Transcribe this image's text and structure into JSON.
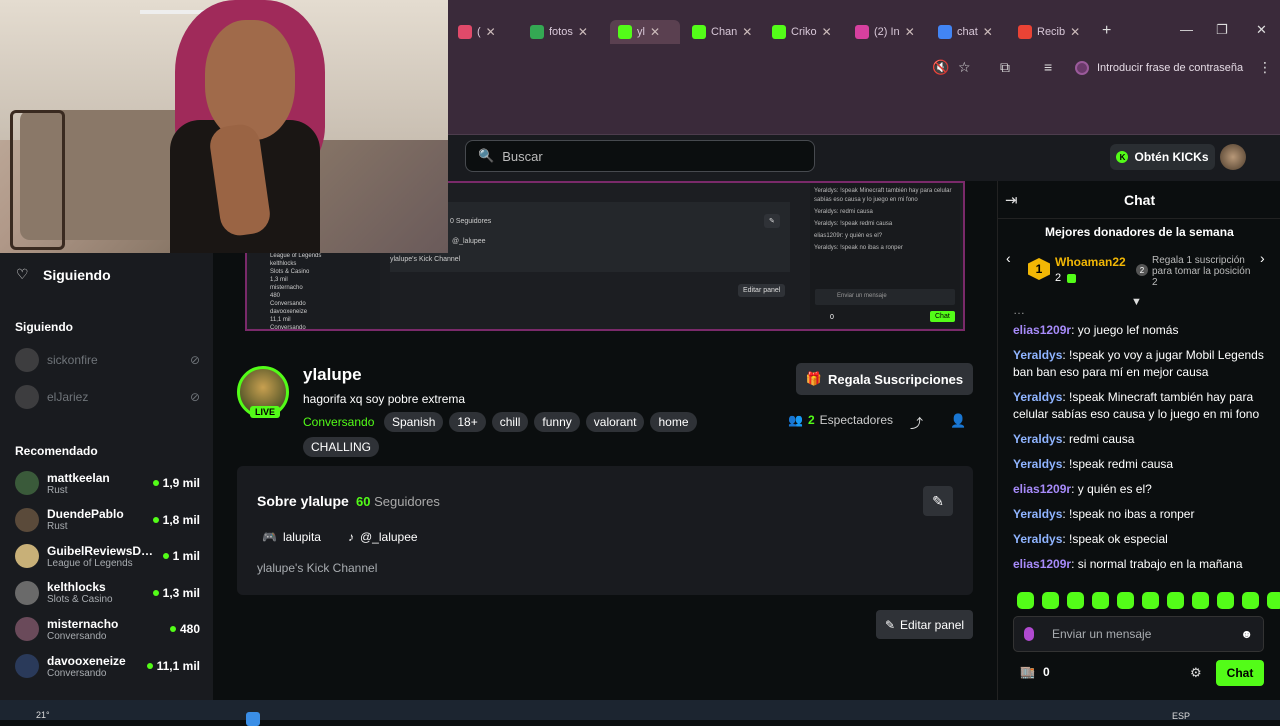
{
  "browser": {
    "tabs": [
      {
        "label": "(",
        "icon_color": "#e04a6a",
        "active": false
      },
      {
        "label": "fotos",
        "icon_color": "#34a853",
        "active": false
      },
      {
        "label": "yl",
        "icon_color": "#53fc18",
        "active": true
      },
      {
        "label": "Chan",
        "icon_color": "#53fc18",
        "active": false
      },
      {
        "label": "Criko",
        "icon_color": "#53fc18",
        "active": false
      },
      {
        "label": "(2) In",
        "icon_color": "#d6409f",
        "active": false
      },
      {
        "label": "chat",
        "icon_color": "#4285f4",
        "active": false
      },
      {
        "label": "Recib",
        "icon_color": "#ea4335",
        "active": false
      }
    ],
    "new_tab": "+",
    "minimize": "—",
    "maximize": "❐",
    "close": "✕",
    "password_prompt": "Introducir frase de contraseña"
  },
  "topbar": {
    "search_placeholder": "Buscar",
    "kicks_label": "Obtén KICKs"
  },
  "sidebar": {
    "following_title": "Siguiendo",
    "following_section": "Siguiendo",
    "following": [
      {
        "name": "sickonfire"
      },
      {
        "name": "elJariez"
      }
    ],
    "recommended_section": "Recomendado",
    "recommended": [
      {
        "name": "mattkeelan",
        "category": "Rust",
        "viewers": "1,9 mil",
        "color": "#3a5a3a"
      },
      {
        "name": "DuendePablo",
        "category": "Rust",
        "viewers": "1,8 mil",
        "color": "#5a4a3a"
      },
      {
        "name": "GuibelReviewsDir...",
        "category": "League of Legends",
        "viewers": "1 mil",
        "color": "#c8b078"
      },
      {
        "name": "kelthlocks",
        "category": "Slots & Casino",
        "viewers": "1,3 mil",
        "color": "#6a6a6a"
      },
      {
        "name": "misternacho",
        "category": "Conversando",
        "viewers": "480",
        "color": "#6a4a5a"
      },
      {
        "name": "davooxeneize",
        "category": "Conversando",
        "viewers": "11,1 mil",
        "color": "#2a3a5a"
      }
    ]
  },
  "video_preview": {
    "followers_text": "0 Seguidores",
    "tiktok": "@_lalupee",
    "channel_desc": "ylalupe's Kick Channel",
    "edit_panel": "Editar panel",
    "sidebar_items": [
      "League of Legends",
      "kelthlocks",
      "Slots & Casino",
      "1,3 mil",
      "misternacho",
      "480",
      "Conversando",
      "davooxeneize",
      "11,1 mil",
      "Conversando"
    ],
    "chat_lines": [
      "Yeraldys: !speak Minecraft también hay para celular sabías eso causa y lo juego en mi fono",
      "Yeraldys: redmi causa",
      "Yeraldys: !speak redmi causa",
      "elias1209r: y quién es el?",
      "Yeraldys: !speak no ibas a ronper"
    ],
    "send_placeholder": "Enviar un mensaje",
    "chat_btn": "Chat",
    "points": "0"
  },
  "channel": {
    "name": "ylalupe",
    "live": "LIVE",
    "title": "hagorifa xq soy pobre extrema",
    "category": "Conversando",
    "tags": [
      "Spanish",
      "18+",
      "chill",
      "funny",
      "valorant",
      "home"
    ],
    "tags2": [
      "CHALLING"
    ],
    "subscribe_btn": "Regala Suscripciones",
    "viewers_count": "2",
    "viewers_label": "Espectadores"
  },
  "about": {
    "title": "Sobre ylalupe",
    "followers_count": "60",
    "followers_label": "Seguidores",
    "discord": "lalupita",
    "tiktok": "@_lalupee",
    "description": "ylalupe's Kick Channel",
    "edit_panel": "Editar panel"
  },
  "chat": {
    "title": "Chat",
    "donors_title": "Mejores donadores de la semana",
    "donor_rank": "1",
    "donor_name": "Whoaman22",
    "donor_value": "2",
    "gift_num": "2",
    "gift_text": "Regala 1 suscripción para tomar la posición 2",
    "messages": [
      {
        "user": "elias1209r",
        "text": " yo juego lef nomás",
        "color": "#a78bfa"
      },
      {
        "user": "Yeraldys",
        "text": " !speak yo voy a jugar Mobil Legends ban ban eso para mí en mejor causa",
        "color": "#8fb4ff"
      },
      {
        "user": "Yeraldys",
        "text": " !speak Minecraft también hay para celular sabías eso causa y lo juego en mi fono",
        "color": "#8fb4ff"
      },
      {
        "user": "Yeraldys",
        "text": " redmi causa",
        "color": "#8fb4ff"
      },
      {
        "user": "Yeraldys",
        "text": " !speak redmi causa",
        "color": "#8fb4ff"
      },
      {
        "user": "elias1209r",
        "text": " y quién es el?",
        "color": "#a78bfa"
      },
      {
        "user": "Yeraldys",
        "text": " !speak no ibas a ronper",
        "color": "#8fb4ff"
      },
      {
        "user": "Yeraldys",
        "text": " !speak ok especial",
        "color": "#8fb4ff"
      },
      {
        "user": "elias1209r",
        "text": " si normal trabajo en la mañana",
        "color": "#a78bfa"
      }
    ],
    "input_placeholder": "Enviar un mensaje",
    "points": "0",
    "send_btn": "Chat"
  },
  "taskbar": {
    "temp": "21°",
    "lang": "ESP"
  }
}
